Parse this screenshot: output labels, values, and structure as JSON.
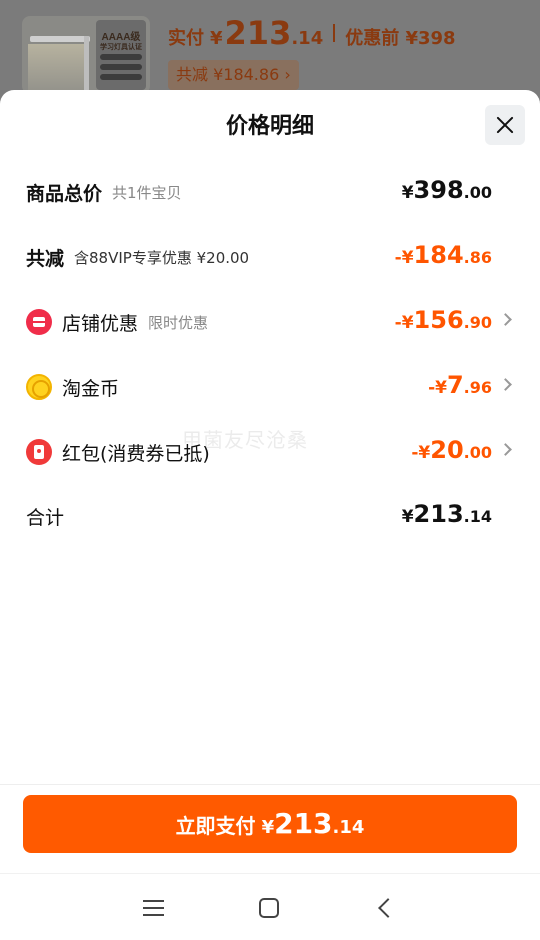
{
  "header": {
    "paid_label": "实付",
    "paid_symbol": "¥",
    "paid_int": "213",
    "paid_dec": ".14",
    "original_label": "优惠前 ¥398",
    "discount_chip": "共减 ¥184.86 ›",
    "thumb_badge": "AAAA级",
    "thumb_sub": "学习灯具认证"
  },
  "sheet": {
    "title": "价格明细",
    "rows": [
      {
        "name": "商品总价",
        "sub": "共1件宝贝",
        "sym": "¥",
        "int": "398",
        "dec": ".00",
        "color": "#111111"
      },
      {
        "name": "共减",
        "sub": "含88VIP专享优惠 ¥20.00",
        "sym": "-¥",
        "int": "184",
        "dec": ".86",
        "color": "#ff5500"
      },
      {
        "name": "店铺优惠",
        "sub": "限时优惠",
        "sym": "-¥",
        "int": "156",
        "dec": ".90",
        "color": "#ff5500",
        "icon": "store-icon"
      },
      {
        "name": "淘金币",
        "sub": "",
        "sym": "-¥",
        "int": "7",
        "dec": ".96",
        "color": "#ff5500",
        "icon": "coin-icon"
      },
      {
        "name": "红包(消费券已抵)",
        "sub": "",
        "sym": "-¥",
        "int": "20",
        "dec": ".00",
        "color": "#ff5500",
        "icon": "red-packet-icon"
      },
      {
        "name": "合计",
        "sub": "",
        "sym": "¥",
        "int": "213",
        "dec": ".14",
        "color": "#111111"
      }
    ],
    "watermark": "甲菌友尽沧桑"
  },
  "pay_button": {
    "label": "立即支付",
    "sym": "¥",
    "int": "213",
    "dec": ".14",
    "color": "#ff5a00"
  },
  "navbar": {
    "icons": [
      "menu-icon",
      "home-icon",
      "back-icon"
    ]
  }
}
